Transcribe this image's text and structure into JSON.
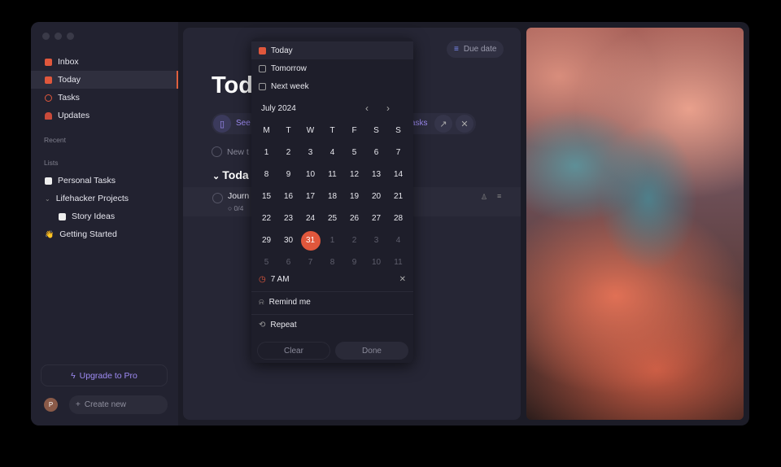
{
  "sidebar": {
    "nav": [
      {
        "label": "Inbox",
        "icon": "inbox-icon",
        "color": "#e0573c"
      },
      {
        "label": "Today",
        "icon": "calendar-icon",
        "color": "#e0573c",
        "active": true
      },
      {
        "label": "Tasks",
        "icon": "check-circle-icon",
        "color": "#e0573c"
      },
      {
        "label": "Updates",
        "icon": "bell-icon",
        "color": "#e0573c"
      }
    ],
    "recent_label": "Recent",
    "lists_label": "Lists",
    "lists": [
      {
        "label": "Personal Tasks"
      },
      {
        "label": "Lifehacker Projects"
      },
      {
        "label": "Story Ideas"
      },
      {
        "label": "Getting Started",
        "emoji": "👋"
      }
    ],
    "upgrade": "Upgrade to Pro",
    "avatar": "P",
    "create": "Create new"
  },
  "main": {
    "title": "Today",
    "due_date": "Due date",
    "banner_see": "See",
    "banner_tasks": "asks",
    "new_task": "New t",
    "section": "Toda",
    "task": {
      "title": "Journ",
      "subtasks": "0/4"
    }
  },
  "picker": {
    "quick": [
      "Today",
      "Tomorrow",
      "Next week"
    ],
    "month": "July 2024",
    "weekdays": [
      "M",
      "T",
      "W",
      "T",
      "F",
      "S",
      "S"
    ],
    "days": [
      "1",
      "2",
      "3",
      "4",
      "5",
      "6",
      "7",
      "8",
      "9",
      "10",
      "11",
      "12",
      "13",
      "14",
      "15",
      "16",
      "17",
      "18",
      "19",
      "20",
      "21",
      "22",
      "23",
      "24",
      "25",
      "26",
      "27",
      "28",
      "29",
      "30",
      "31",
      "1",
      "2",
      "3",
      "4",
      "5",
      "6",
      "7",
      "8",
      "9",
      "10",
      "11"
    ],
    "selected": "31",
    "time": "7 AM",
    "remind": "Remind me",
    "repeat": "Repeat",
    "clear": "Clear",
    "done": "Done"
  },
  "colors": {
    "accent": "#e0573c",
    "pro": "#9f8cf5"
  }
}
